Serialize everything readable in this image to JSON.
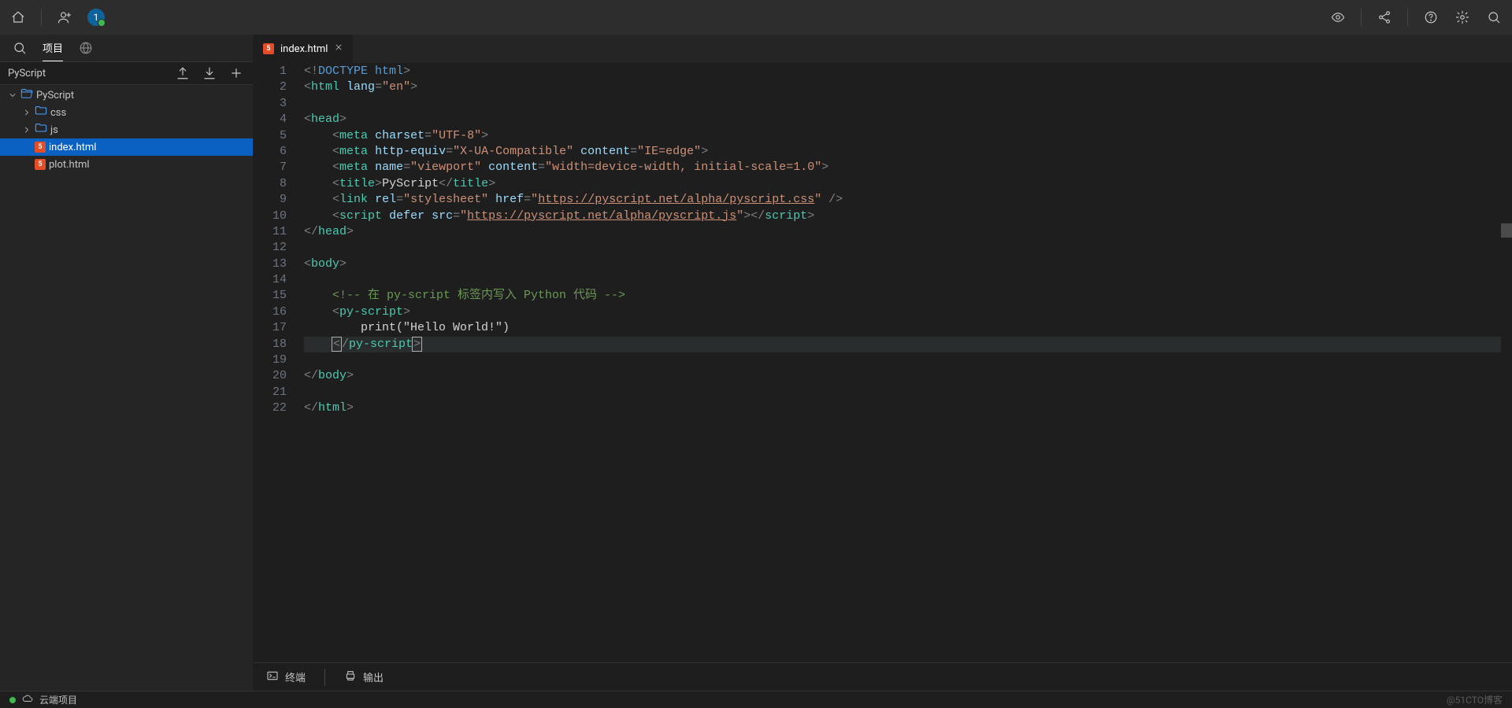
{
  "topbar": {
    "avatar_text": "1"
  },
  "sidebar": {
    "tab_project": "项目",
    "project_title": "PyScript",
    "tree": [
      {
        "type": "folder-open",
        "name": "PyScript",
        "indent": 0
      },
      {
        "type": "folder",
        "name": "css",
        "indent": 1
      },
      {
        "type": "folder",
        "name": "js",
        "indent": 1
      },
      {
        "type": "html",
        "name": "index.html",
        "indent": 1,
        "selected": true
      },
      {
        "type": "html",
        "name": "plot.html",
        "indent": 1
      }
    ]
  },
  "editor": {
    "tab_name": "index.html",
    "line_count": 22,
    "highlight_line": 18,
    "code": {
      "l1": {
        "doctype": "DOCTYPE",
        "html": "html"
      },
      "l2": {
        "tag": "html",
        "attr": "lang",
        "val": "\"en\""
      },
      "l4": {
        "tag": "head"
      },
      "l5": {
        "tag": "meta",
        "attr": "charset",
        "val": "\"UTF-8\""
      },
      "l6": {
        "tag": "meta",
        "a1": "http-equiv",
        "v1": "\"X-UA-Compatible\"",
        "a2": "content",
        "v2": "\"IE=edge\""
      },
      "l7": {
        "tag": "meta",
        "a1": "name",
        "v1": "\"viewport\"",
        "a2": "content",
        "v2": "\"width=device-width, initial-scale=1.0\""
      },
      "l8": {
        "tag": "title",
        "text": "PyScript"
      },
      "l9": {
        "tag": "link",
        "a1": "rel",
        "v1": "\"stylesheet\"",
        "a2": "href",
        "url": "https://pyscript.net/alpha/pyscript.css"
      },
      "l10": {
        "tag": "script",
        "a1": "defer",
        "a2": "src",
        "url": "https://pyscript.net/alpha/pyscript.js"
      },
      "l11": {
        "tag": "head"
      },
      "l13": {
        "tag": "body"
      },
      "l15": {
        "comment": "<!-- 在 py-script 标签内写入 Python 代码 -->"
      },
      "l16": {
        "tag": "py-script"
      },
      "l17": {
        "text": "print(\"Hello World!\")"
      },
      "l18": {
        "tag": "py-script"
      },
      "l20": {
        "tag": "body"
      },
      "l22": {
        "tag": "html"
      }
    }
  },
  "panel": {
    "terminal": "终端",
    "output": "输出"
  },
  "status": {
    "cloud": "云端项目",
    "watermark": "@51CTO博客"
  }
}
